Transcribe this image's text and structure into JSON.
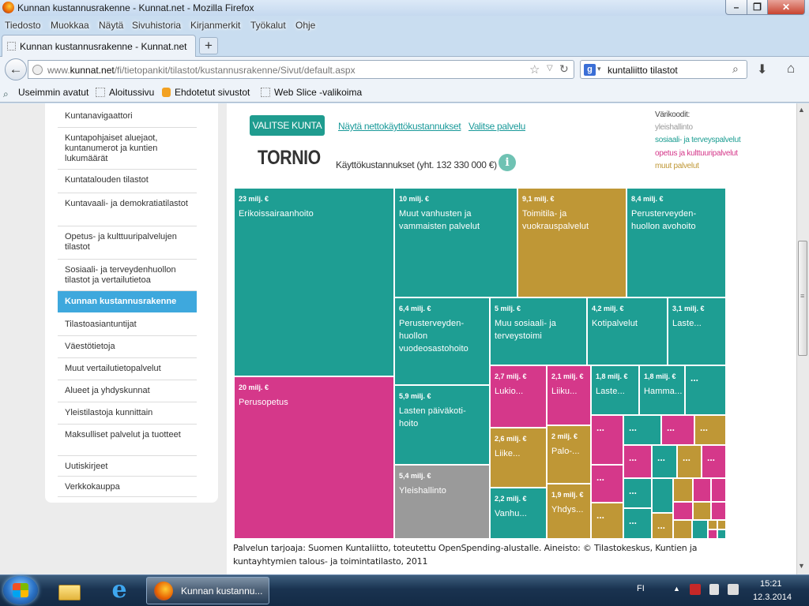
{
  "window": {
    "title": "Kunnan kustannusrakenne - Kunnat.net - Mozilla Firefox",
    "min": "–",
    "max": "❐",
    "close": "✕"
  },
  "menu": [
    "Tiedosto",
    "Muokkaa",
    "Näytä",
    "Sivuhistoria",
    "Kirjanmerkit",
    "Työkalut",
    "Ohje"
  ],
  "tab": {
    "label": "Kunnan kustannusrakenne - Kunnat.net",
    "new": "+"
  },
  "nav": {
    "url_pre": "www.",
    "url_domain": "kunnat.net",
    "url_path": "/fi/tietopankit/tilastot/kustannusrakenne/Sivut/default.aspx",
    "search_value": "kuntaliitto tilastot",
    "search_engine": "g",
    "back": "←",
    "star": "☆",
    "dropdown": "▽",
    "reload": "↻",
    "magnifier": "⌕",
    "download": "⬇",
    "home": "⌂"
  },
  "bookmarks": [
    "Useimmin avatut",
    "Aloitussivu",
    "Ehdotetut sivustot",
    "Web Slice -valikoima"
  ],
  "sidebar": {
    "items": [
      {
        "label": "Kuntanavigaattori",
        "active": false
      },
      {
        "label": "Kuntapohjaiset aluejaot, kuntanumerot ja kuntien lukumäärät",
        "active": false
      },
      {
        "label": "Kuntatalouden tilastot",
        "active": false
      },
      {
        "label": "Kuntavaali- ja demokratiatilastot",
        "active": false
      },
      {
        "label": "Opetus- ja kulttuuripalvelujen tilastot",
        "active": false
      },
      {
        "label": "Sosiaali- ja terveydenhuollon tilastot ja vertailutietoa",
        "active": false
      },
      {
        "label": "Kunnan kustannusrakenne",
        "active": true
      },
      {
        "label": "Tilastoasiantuntijat",
        "active": false
      },
      {
        "label": "Väestötietoja",
        "active": false
      },
      {
        "label": "Muut vertailutietopalvelut",
        "active": false
      },
      {
        "label": "Alueet ja yhdyskunnat",
        "active": false
      },
      {
        "label": "Yleistilastoja kunnittain",
        "active": false
      },
      {
        "label": "Maksulliset palvelut ja tuotteet",
        "active": false
      },
      {
        "label": "Uutiskirjeet",
        "active": false
      },
      {
        "label": "Verkkokauppa",
        "active": false
      }
    ]
  },
  "controls": {
    "select_municipality": "VALITSE KUNTA",
    "net_costs_link": "Näytä nettokäyttökustannukset",
    "select_service_link": "Valitse palvelu"
  },
  "legend": {
    "title": "Värikoodit:",
    "items": [
      {
        "label": "yleishallinto",
        "color": "#9a9a9a"
      },
      {
        "label": "sosiaali- ja terveyspalvelut",
        "color": "#1e9e93"
      },
      {
        "label": "opetus ja kulttuuripalvelut",
        "color": "#d5388a"
      },
      {
        "label": "muut palvelut",
        "color": "#bf9736"
      }
    ]
  },
  "summary": {
    "municipality": "TORNIO",
    "costs": "Käyttökustannukset (yht. 132 330 000 €)",
    "info": "i"
  },
  "treemap": {
    "tiles": [
      {
        "amount": "23 milj. €",
        "label": "Erikoissairaanhoito",
        "category": "social"
      },
      {
        "amount": "20 milj. €",
        "label": "Perusopetus",
        "category": "education"
      },
      {
        "amount": "10 milj. €",
        "label": "Muut vanhusten ja\nvammaisten palvelut",
        "category": "social"
      },
      {
        "amount": "9,1 milj. €",
        "label": "Toimitila- ja\nvuokrauspalvelut",
        "category": "other"
      },
      {
        "amount": "8,4 milj. €",
        "label": "Perusterveyden-\nhuollon avohoito",
        "category": "social"
      },
      {
        "amount": "6,4 milj. €",
        "label": "Perusterveyden-\nhuollon\nvuodeosastohoito",
        "category": "social"
      },
      {
        "amount": "5 milj. €",
        "label": "Muu sosiaali- ja\nterveystoimi",
        "category": "social"
      },
      {
        "amount": "4,2 milj. €",
        "label": "Kotipalvelut",
        "category": "social"
      },
      {
        "amount": "3,1 milj. €",
        "label": "Laste...",
        "category": "social"
      },
      {
        "amount": "5,9 milj. €",
        "label": "Lasten päiväkoti-\nhoito",
        "category": "social"
      },
      {
        "amount": "5,4 milj. €",
        "label": "Yleishallinto",
        "category": "admin"
      },
      {
        "amount": "2,7 milj. €",
        "label": "Lukio...",
        "category": "education"
      },
      {
        "amount": "2,1 milj. €",
        "label": "Liiku...",
        "category": "education"
      },
      {
        "amount": "1,8 milj. €",
        "label": "Laste...",
        "category": "social"
      },
      {
        "amount": "1,8 milj. €",
        "label": "Hamma...",
        "category": "social"
      },
      {
        "amount": "2,6 milj. €",
        "label": "Liike...",
        "category": "other"
      },
      {
        "amount": "2 milj. €",
        "label": "Palo-...",
        "category": "other"
      },
      {
        "amount": "2,2 milj. €",
        "label": "Vanhu...",
        "category": "social"
      },
      {
        "amount": "1,9 milj. €",
        "label": "Yhdys...",
        "category": "other"
      }
    ],
    "ellipsis": "..."
  },
  "footer_note": "Palvelun tarjoaja: Suomen Kuntaliitto, toteutettu OpenSpending-alustalle. Aineisto: © Tilastokeskus, Kuntien ja kuntayhtymien talous- ja toimintatilasto, 2011",
  "taskbar": {
    "firefox_task": "Kunnan kustannu...",
    "language": "FI",
    "tray_up": "▲",
    "time": "15:21",
    "date": "12.3.2014"
  }
}
